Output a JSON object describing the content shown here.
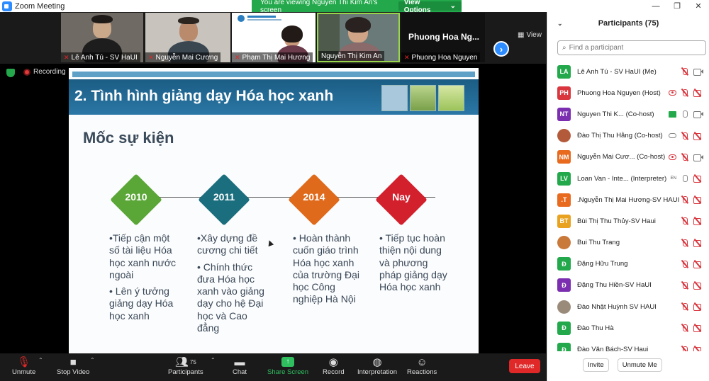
{
  "window": {
    "title": "Zoom Meeting"
  },
  "banner": {
    "message": "You are viewing Nguyen Thi Kim An's screen",
    "options_label": "View Options"
  },
  "gallery": {
    "tiles": [
      {
        "name": "Lê Anh Tú - SV HaUI"
      },
      {
        "name": "Nguyễn Mai Cương"
      },
      {
        "name": "Phạm Thị Mai Hương"
      },
      {
        "name": "Nguyễn Thị Kim An"
      },
      {
        "name": "Phuong Hoa Nguyen",
        "display_name": "Phuong Hoa Ng..."
      }
    ],
    "view_label": "View"
  },
  "status": {
    "recording_label": "Recording"
  },
  "slide": {
    "title": "2. Tình hình giảng dạy Hóa học xanh",
    "subtitle": "Mốc sự kiện",
    "milestones": [
      {
        "label": "2010",
        "color": "#5aa637",
        "bullets": [
          "•Tiếp cận một số tài liệu Hóa học xanh nước ngoài",
          "• Lên ý tưởng giảng dạy Hóa học xanh"
        ]
      },
      {
        "label": "2011",
        "color": "#1b6e7e",
        "bullets": [
          "•Xây dựng đề cương chi tiết",
          "• Chính thức đưa Hóa học xanh vào giảng dạy cho hệ Đại học và Cao đẳng"
        ]
      },
      {
        "label": "2014",
        "color": "#e06a1b",
        "bullets": [
          "• Hoàn thành cuốn giáo trình Hóa học xanh của trường Đại học Công nghiệp Hà Nội"
        ]
      },
      {
        "label": "Nay",
        "color": "#d3202d",
        "bullets": [
          "• Tiếp tục hoàn thiện nội dung và phương pháp giảng dạy Hóa học xanh"
        ]
      }
    ]
  },
  "toolbar": {
    "unmute": "Unmute",
    "stop_video": "Stop Video",
    "participants": "Participants",
    "participants_count": "75",
    "chat": "Chat",
    "share_screen": "Share Screen",
    "record": "Record",
    "interpretation": "Interpretation",
    "reactions": "Reactions",
    "leave": "Leave"
  },
  "panel": {
    "title": "Participants (75)",
    "search_placeholder": "Find a participant",
    "participants": [
      {
        "initials": "LA",
        "color": "#23a94b",
        "name": "Lê Anh Tú - SV HaUI (Me)",
        "mic": "muted",
        "cam": "on",
        "extra": ""
      },
      {
        "initials": "PH",
        "color": "#d9363e",
        "name": "Phuong Hoa Nguyen (Host)",
        "mic": "muted",
        "cam": "off",
        "extra": "rec"
      },
      {
        "initials": "NT",
        "color": "#7b2fb0",
        "name": "Nguyen Thi K...  (Co-host)",
        "mic": "on",
        "cam": "on",
        "extra": "share"
      },
      {
        "initials": "",
        "color": "#b35a3a",
        "name": "Đào Thị Thu Hằng (Co-host)",
        "mic": "muted",
        "cam": "off",
        "extra": "cloud"
      },
      {
        "initials": "NM",
        "color": "#e86a1f",
        "name": "Nguyễn Mai Cươ...  (Co-host)",
        "mic": "muted",
        "cam": "on",
        "extra": "rec"
      },
      {
        "initials": "LV",
        "color": "#23a94b",
        "name": "Loan Van - Inte... (Interpreter)",
        "mic": "on",
        "cam": "off",
        "extra": "en"
      },
      {
        "initials": ".T",
        "color": "#e86a1f",
        "name": ".Nguyễn Thị Mai Hương-SV HAUI",
        "mic": "muted",
        "cam": "off",
        "extra": ""
      },
      {
        "initials": "BT",
        "color": "#e8a21f",
        "name": "Bùi Thị Thu Thủy-SV Haui",
        "mic": "muted",
        "cam": "off",
        "extra": ""
      },
      {
        "initials": "",
        "color": "#c9793a",
        "name": "Bui Thu Trang",
        "mic": "muted",
        "cam": "off",
        "extra": ""
      },
      {
        "initials": "Đ",
        "color": "#23a94b",
        "name": "Đặng Hữu Trung",
        "mic": "muted",
        "cam": "off",
        "extra": ""
      },
      {
        "initials": "Đ",
        "color": "#7b2fb0",
        "name": "Đặng Thu Hiền-SV HaUI",
        "mic": "muted",
        "cam": "off",
        "extra": ""
      },
      {
        "initials": "",
        "color": "#9a8a7a",
        "name": "Đào Nhật Huỳnh SV HAUI",
        "mic": "muted",
        "cam": "off",
        "extra": ""
      },
      {
        "initials": "Đ",
        "color": "#23a94b",
        "name": "Đào Thu Hà",
        "mic": "muted",
        "cam": "off",
        "extra": ""
      },
      {
        "initials": "Đ",
        "color": "#23a94b",
        "name": "Đào Văn Bách-SV Haui",
        "mic": "muted",
        "cam": "off",
        "extra": ""
      }
    ],
    "invite": "Invite",
    "unmute_me": "Unmute Me"
  }
}
